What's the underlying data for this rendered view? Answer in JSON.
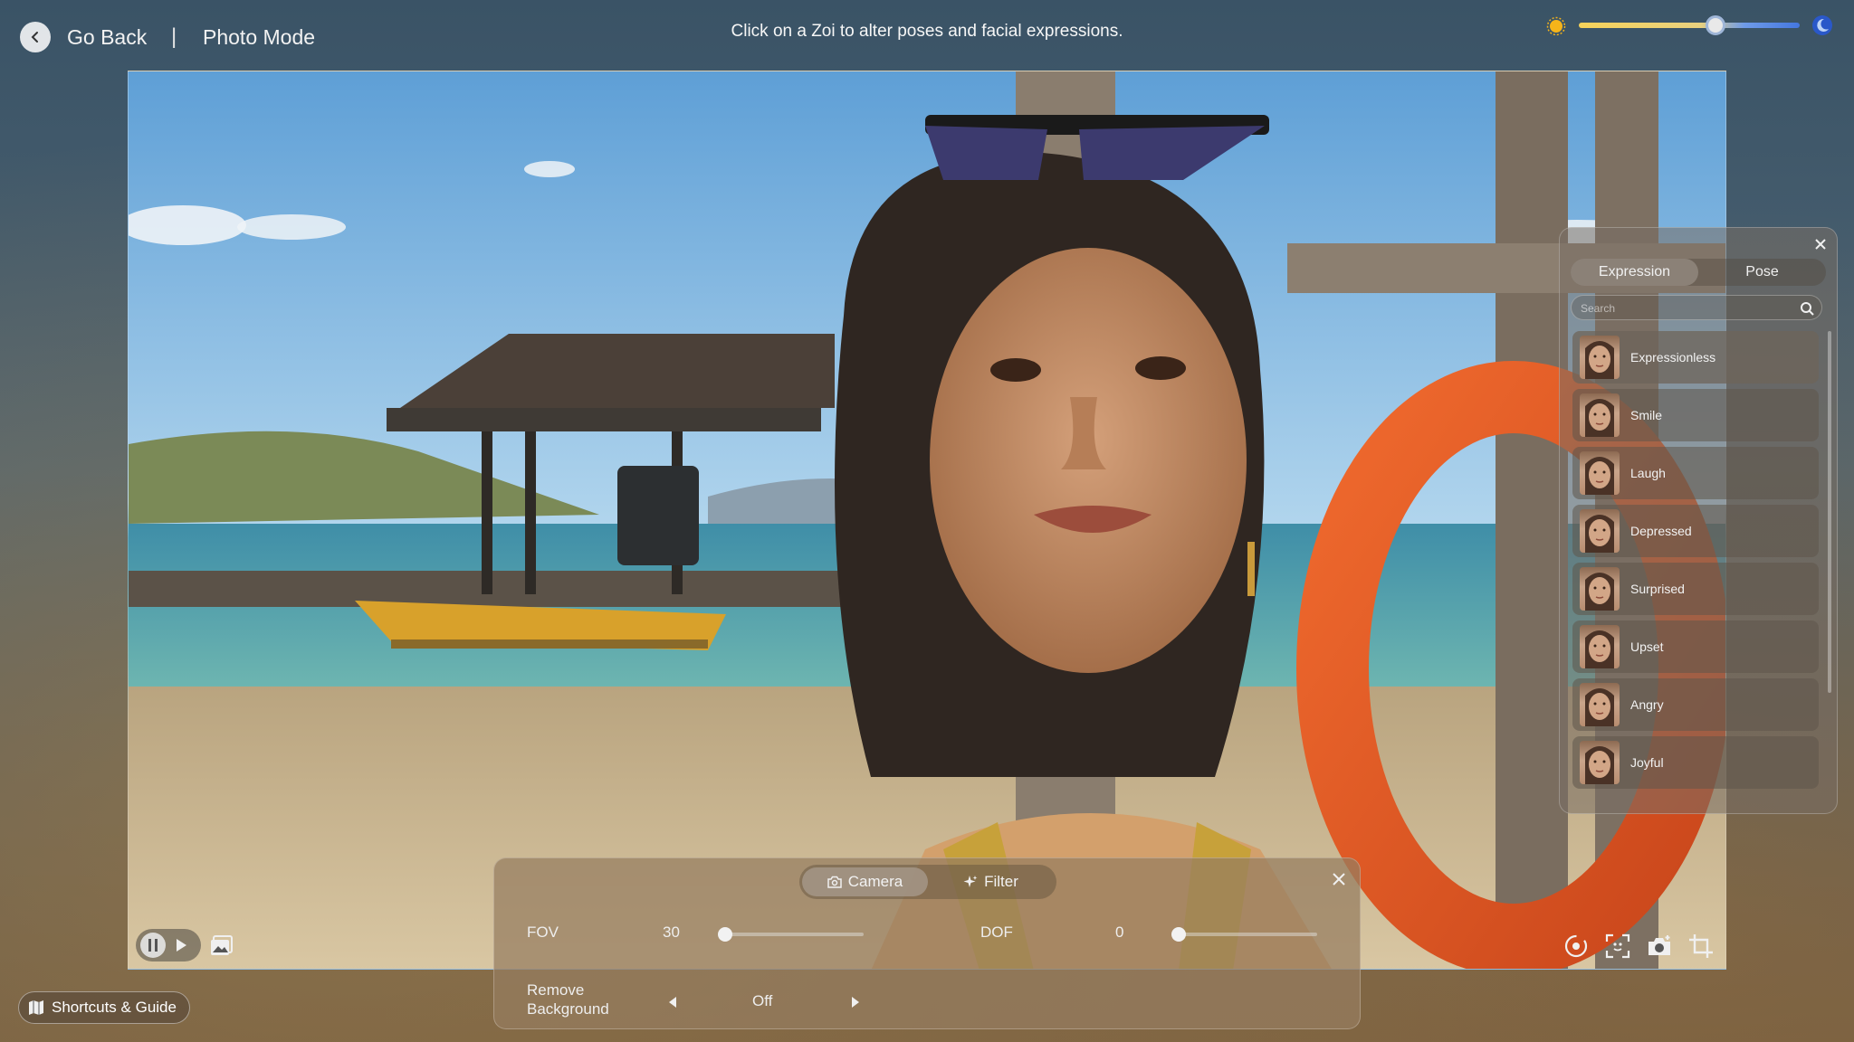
{
  "header": {
    "back_label": "Go Back",
    "divider": "|",
    "mode_title": "Photo Mode",
    "hint": "Click on a Zoi to alter poses and facial expressions."
  },
  "time_of_day": {
    "value": 0.62,
    "start_icon": "sun-icon",
    "end_icon": "moon-icon"
  },
  "playback": {
    "pause_icon": "pause-icon",
    "play_icon": "play-icon",
    "gallery_icon": "gallery-icon"
  },
  "tools": [
    "rotate-camera-icon",
    "focus-frame-icon",
    "capture-photo-icon",
    "crop-icon"
  ],
  "expression_panel": {
    "tabs": [
      {
        "label": "Expression",
        "active": true
      },
      {
        "label": "Pose",
        "active": false
      }
    ],
    "search_placeholder": "Search",
    "items": [
      {
        "label": "Expressionless"
      },
      {
        "label": "Smile"
      },
      {
        "label": "Laugh"
      },
      {
        "label": "Depressed"
      },
      {
        "label": "Surprised"
      },
      {
        "label": "Upset"
      },
      {
        "label": "Angry"
      },
      {
        "label": "Joyful"
      }
    ]
  },
  "camera_panel": {
    "tabs": [
      {
        "label": "Camera",
        "icon": "camera-icon",
        "active": true
      },
      {
        "label": "Filter",
        "icon": "sparkle-icon",
        "active": false
      }
    ],
    "fov": {
      "label": "FOV",
      "value": "30",
      "level": 0.0
    },
    "dof": {
      "label": "DOF",
      "value": "0",
      "level": 0.0
    },
    "remove_background": {
      "label_line1": "Remove",
      "label_line2": "Background",
      "value": "Off"
    }
  },
  "shortcuts": {
    "label": "Shortcuts & Guide"
  },
  "colors": {
    "sun": "#f5b41a",
    "moon": "#5a8de6",
    "slider_warm": "#f7d35a",
    "slider_cool": "#4477e0"
  }
}
